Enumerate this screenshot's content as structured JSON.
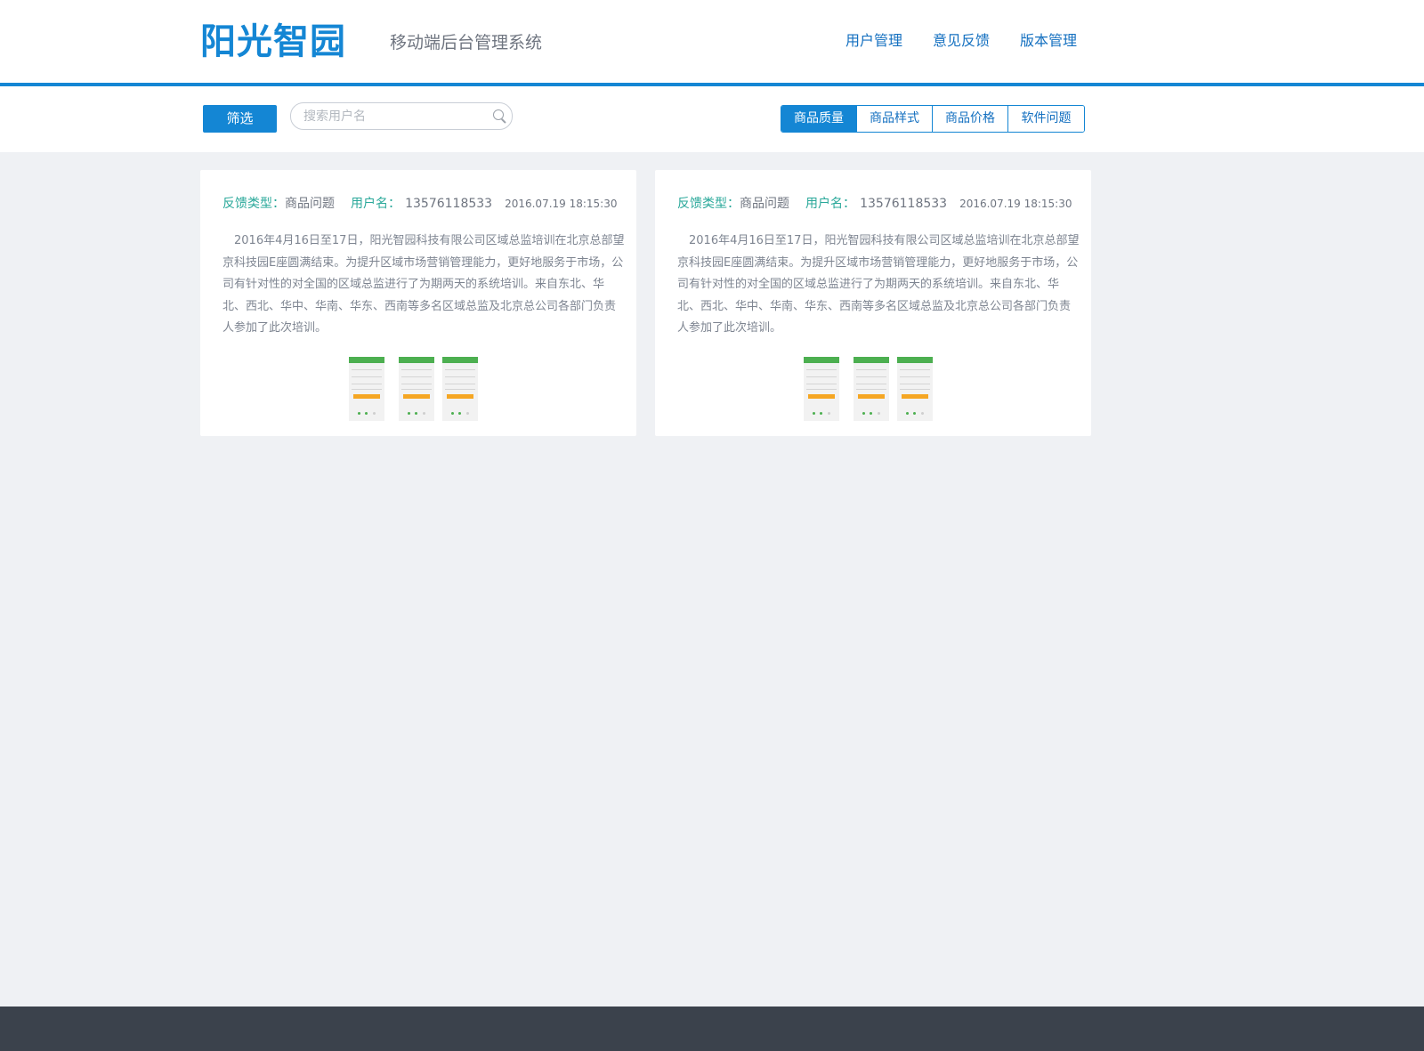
{
  "header": {
    "logo_text": "阳光智园",
    "subtitle": "移动端后台管理系统",
    "nav": [
      "用户管理",
      "意见反馈",
      "版本管理"
    ]
  },
  "toolbar": {
    "filter_label": "筛选",
    "search_placeholder": "搜索用户名",
    "tabs": [
      "商品质量",
      "商品样式",
      "商品价格",
      "软件问题"
    ],
    "active_tab": "商品质量"
  },
  "cards": [
    {
      "type_label": "反馈类型：",
      "type_value": "商品问题",
      "user_label": "用户名：",
      "user_value": "13576118533",
      "time": "2016.07.19 18:15:30",
      "body": "2016年4月16日至17日，阳光智园科技有限公司区域总监培训在北京总部望京科技园E座圆满结束。为提升区域市场营销管理能力，更好地服务于市场，公司有针对性的对全国的区域总监进行了为期两天的系统培训。来自东北、华北、西北、华中、华南、华东、西南等多名区域总监及北京总公司各部门负责人参加了此次培训。"
    },
    {
      "type_label": "反馈类型：",
      "type_value": "商品问题",
      "user_label": "用户名：",
      "user_value": "13576118533",
      "time": "2016.07.19 18:15:30",
      "body": "2016年4月16日至17日，阳光智园科技有限公司区域总监培训在北京总部望京科技园E座圆满结束。为提升区域市场营销管理能力，更好地服务于市场，公司有针对性的对全国的区域总监进行了为期两天的系统培训。来自东北、华北、西北、华中、华南、华东、西南等多名区域总监及北京总公司各部门负责人参加了此次培训。"
    }
  ],
  "colors": {
    "accent": "#1486d4",
    "label_green": "#2aa89a",
    "footer": "#3b424c",
    "page_bg": "#eff1f4"
  }
}
